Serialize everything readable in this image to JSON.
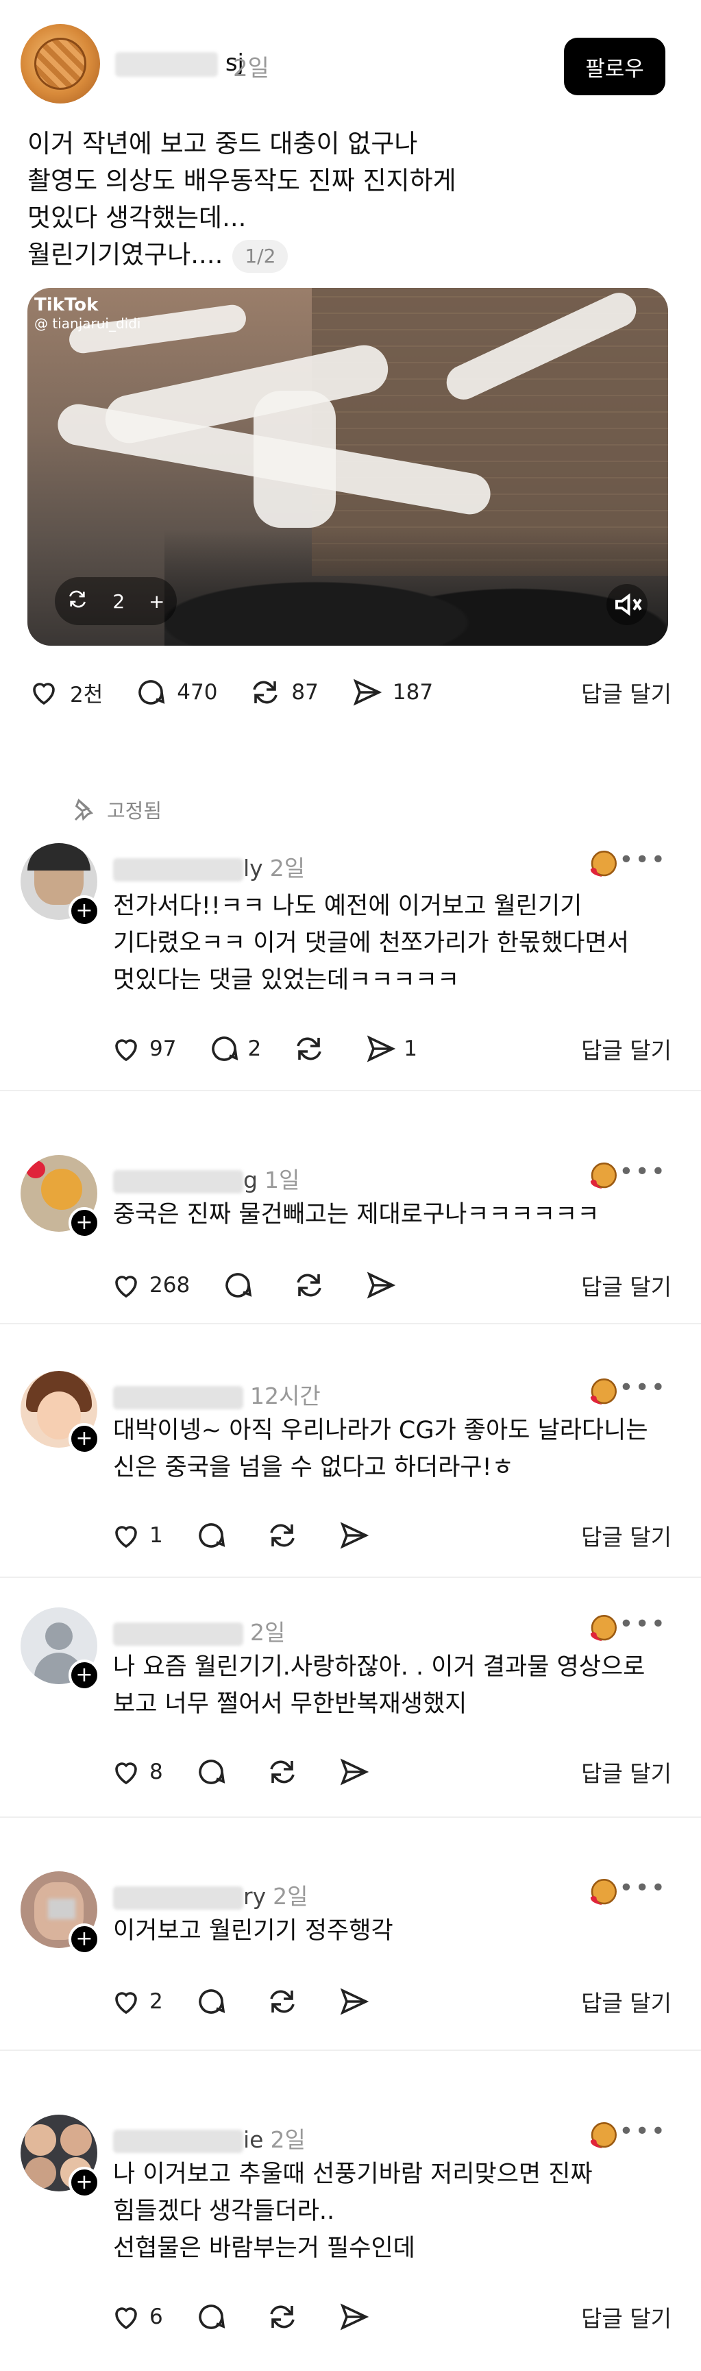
{
  "post": {
    "author_suffix": "sj",
    "time": "2일",
    "follow_label": "팔로우",
    "body_lines": [
      "이거 작년에 보고 중드 대충이 없구나",
      "촬영도 의상도 배우동작도 진짜 진지하게",
      "멋있다 생각했는데...",
      "월린기기였구나...."
    ],
    "page_indicator": "1/2",
    "media": {
      "watermark_brand": "TikTok",
      "watermark_handle": "@ tianjarui_didi",
      "repost_count": "2",
      "add_label": "+"
    },
    "actions": {
      "likes": "2천",
      "comments": "470",
      "reposts": "87",
      "shares": "187",
      "reply_label": "답글 달기"
    }
  },
  "pinned_label": "고정됨",
  "comments": [
    {
      "name_tail": "ly",
      "time": "2일",
      "lines": [
        "전가서다!!ㅋㅋ 나도 예전에 이거보고 월린기기",
        "기다렸오ㅋㅋ 이거 댓글에 천쪼가리가 한몫했다면서",
        "멋있다는 댓글 있었는데ㅋㅋㅋㅋㅋ"
      ],
      "likes": "97",
      "comments": "2",
      "reposts": "",
      "shares": "1",
      "reply_label": "답글 달기"
    },
    {
      "name_tail": "g",
      "time": "1일",
      "lines": [
        "중국은 진짜 물건빼고는 제대로구나ㅋㅋㅋㅋㅋㅋ"
      ],
      "likes": "268",
      "comments": "",
      "reposts": "",
      "shares": "",
      "reply_label": "답글 달기"
    },
    {
      "name_tail": "",
      "time": "12시간",
      "lines": [
        "대박이넹~ 아직 우리나라가 CG가 좋아도 날라다니는",
        "신은 중국을 넘을 수 없다고 하더라구!ㅎ"
      ],
      "likes": "1",
      "comments": "",
      "reposts": "",
      "shares": "",
      "reply_label": "답글 달기"
    },
    {
      "name_tail": "",
      "time": "2일",
      "lines": [
        "나 요즘 월린기기.사랑하잖아. . 이거 결과물 영상으로",
        "보고 너무 쩔어서 무한반복재생했지"
      ],
      "likes": "8",
      "comments": "",
      "reposts": "",
      "shares": "",
      "reply_label": "답글 달기"
    },
    {
      "name_tail": "ry",
      "time": "2일",
      "lines": [
        "이거보고 월린기기 정주행각"
      ],
      "likes": "2",
      "comments": "",
      "reposts": "",
      "shares": "",
      "reply_label": "답글 달기"
    },
    {
      "name_tail": "ie",
      "time": "2일",
      "lines": [
        "나 이거보고 추울때 선풍기바람 저리맞으면 진짜",
        "힘들겠다 생각들더라..",
        "선협물은 바람부는거 필수인데"
      ],
      "likes": "6",
      "comments": "",
      "reposts": "",
      "shares": "",
      "reply_label": "답글 달기"
    }
  ],
  "colors": {
    "follow_bg": "#000000",
    "muted": "#999999",
    "badge": "#e8a33b",
    "heart_badge": "#e0243a"
  }
}
